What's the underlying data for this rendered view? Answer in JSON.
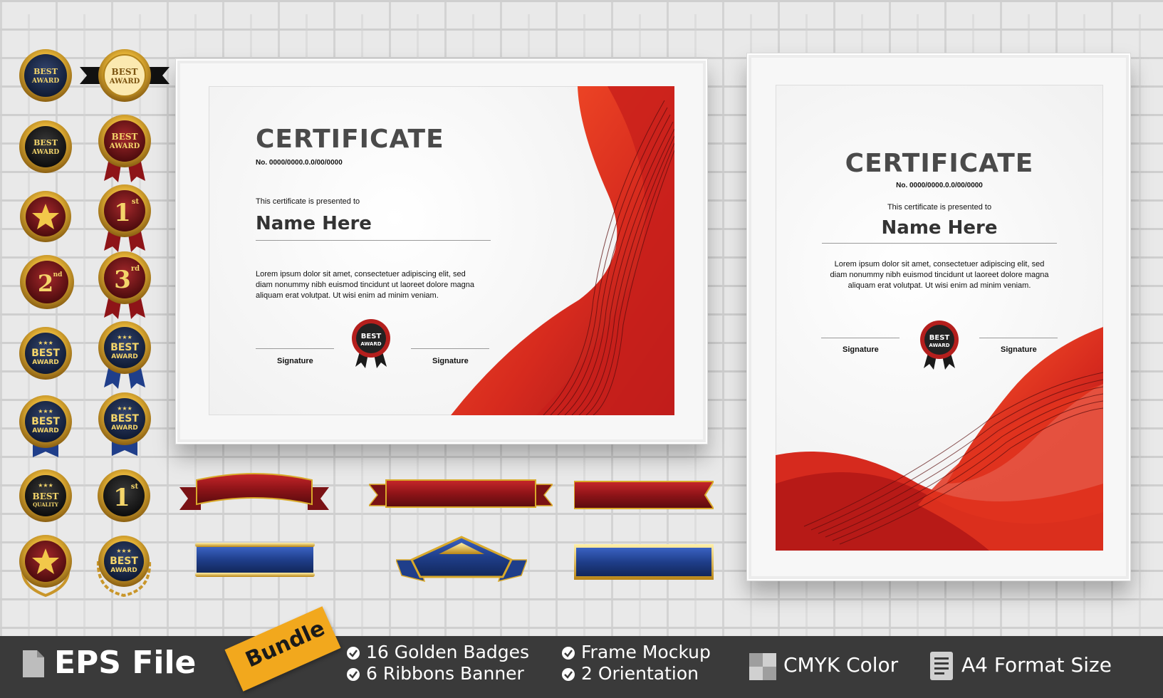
{
  "badges": [
    {
      "top": "BEST",
      "bottom": "AWARD"
    },
    {
      "top": "BEST",
      "bottom": "AWARD"
    },
    {
      "top": "BEST",
      "bottom": "AWARD"
    },
    {
      "top": "BEST",
      "bottom": "AWARD"
    },
    {
      "rank": "1",
      "sup": "st"
    },
    {
      "rank": "2",
      "sup": "nd"
    },
    {
      "rank": "3",
      "sup": "rd"
    },
    {
      "top": "BEST",
      "bottom": "AWARD"
    },
    {
      "top": "BEST",
      "bottom": "AWARD"
    },
    {
      "top": "BEST",
      "bottom": "AWARD"
    },
    {
      "top": "BEST",
      "bottom": "AWARD"
    },
    {
      "top": "BEST",
      "bottom": "QUALITY"
    },
    {
      "rank": "1",
      "sup": "st"
    },
    {
      "top": "BEST",
      "bottom": "AWARD"
    }
  ],
  "cert_landscape": {
    "title": "CERTIFICATE",
    "number": "No. 0000/0000.0.0/00/0000",
    "presented": "This certificate is presented to",
    "name": "Name Here",
    "body_1": "Lorem ipsum dolor sit amet, consectetuer adipiscing elit, sed",
    "body_2": "diam nonummy nibh euismod tincidunt ut laoreet dolore magna",
    "body_3": "aliquam erat volutpat. Ut wisi enim ad minim veniam.",
    "signature_left": "Signature",
    "signature_right": "Signature",
    "seal_top": "BEST",
    "seal_bottom": "AWARD"
  },
  "cert_portrait": {
    "title": "CERTIFICATE",
    "number": "No. 0000/0000.0.0/00/0000",
    "presented": "This certificate is presented to",
    "name": "Name Here",
    "body_1": "Lorem ipsum dolor sit amet, consectetuer adipiscing elit, sed",
    "body_2": "diam nonummy nibh euismod tincidunt ut laoreet dolore magna",
    "body_3": "aliquam erat volutpat. Ut wisi enim ad minim veniam.",
    "signature_left": "Signature",
    "signature_right": "Signature",
    "seal_top": "BEST",
    "seal_bottom": "AWARD"
  },
  "footer": {
    "file_label": "EPS File",
    "bundle_tag": "Bundle",
    "feature_1": "16 Golden Badges",
    "feature_2": "6  Ribbons Banner",
    "feature_3": "Frame Mockup",
    "feature_4": "2 Orientation",
    "feature_5": "CMYK Color",
    "feature_6": "A4 Format Size"
  },
  "icons": [
    "file-icon",
    "check-icon",
    "cmyk-swatch-icon",
    "document-icon"
  ],
  "colors": {
    "accent_red": "#d62a1e",
    "gold": "#d9a92a",
    "navy": "#1c2a4a",
    "maroon": "#7a1518",
    "ribbon_blue": "#1f3e8a",
    "footer_bg": "#3a3a3a",
    "bundle_tag": "#f2a81d"
  }
}
